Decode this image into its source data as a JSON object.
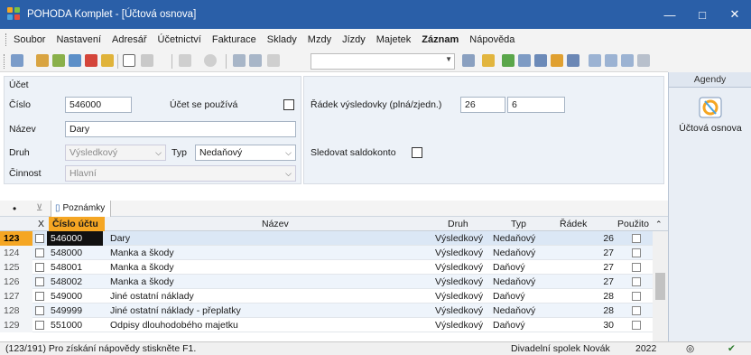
{
  "window": {
    "title": "POHODA Komplet - [Účtová osnova]",
    "buttons": {
      "minimize": "—",
      "maximize": "□",
      "close": "✕"
    }
  },
  "menu": [
    "Soubor",
    "Nastavení",
    "Adresář",
    "Účetnictví",
    "Fakturace",
    "Sklady",
    "Mzdy",
    "Jízdy",
    "Majetek",
    "Záznam",
    "Nápověda"
  ],
  "menu_bold_index": 9,
  "agenda": {
    "header": "Agendy",
    "item_label": "Účtová osnova"
  },
  "form": {
    "section_title": "Účet",
    "cislo_label": "Číslo",
    "cislo_value": "546000",
    "pouziva_label": "Účet se používá",
    "nazev_label": "Název",
    "nazev_value": "Dary",
    "druh_label": "Druh",
    "druh_value": "Výsledkový",
    "typ_label": "Typ",
    "typ_value": "Nedaňový",
    "cinnost_label": "Činnost",
    "cinnost_value": "Hlavní",
    "radek_label": "Řádek výsledovky (plná/zjedn.)",
    "radek_plna": "26",
    "radek_zjedn": "6",
    "saldokonto_label": "Sledovat saldokonto"
  },
  "tabs": {
    "pin": "•",
    "poznamky": "Poznámky"
  },
  "grid": {
    "headers": {
      "x": "X",
      "cislo": "Číslo účtu",
      "nazev": "Název",
      "druh": "Druh",
      "typ": "Typ",
      "radek": "Řádek",
      "pouzito": "Použito"
    },
    "rows": [
      {
        "n": "123",
        "cislo": "546000",
        "nazev": "Dary",
        "druh": "Výsledkový",
        "typ": "Nedaňový",
        "radek": "26"
      },
      {
        "n": "124",
        "cislo": "548000",
        "nazev": "Manka a škody",
        "druh": "Výsledkový",
        "typ": "Nedaňový",
        "radek": "27"
      },
      {
        "n": "125",
        "cislo": "548001",
        "nazev": "Manka a škody",
        "druh": "Výsledkový",
        "typ": "Daňový",
        "radek": "27"
      },
      {
        "n": "126",
        "cislo": "548002",
        "nazev": "Manka a škody",
        "druh": "Výsledkový",
        "typ": "Nedaňový",
        "radek": "27"
      },
      {
        "n": "127",
        "cislo": "549000",
        "nazev": "Jiné ostatní náklady",
        "druh": "Výsledkový",
        "typ": "Daňový",
        "radek": "28"
      },
      {
        "n": "128",
        "cislo": "549999",
        "nazev": "Jiné ostatní náklady - přeplatky",
        "druh": "Výsledkový",
        "typ": "Nedaňový",
        "radek": "28"
      },
      {
        "n": "129",
        "cislo": "551000",
        "nazev": "Odpisy dlouhodobého majetku",
        "druh": "Výsledkový",
        "typ": "Daňový",
        "radek": "30"
      }
    ]
  },
  "status": {
    "help": "(123/191) Pro získání nápovědy stiskněte F1.",
    "company": "Divadelní spolek Novák",
    "year": "2022"
  },
  "colors": {
    "titlebar": "#2a5fa8",
    "selected_row_number": "#f5a623",
    "panel": "#edf2f8"
  }
}
